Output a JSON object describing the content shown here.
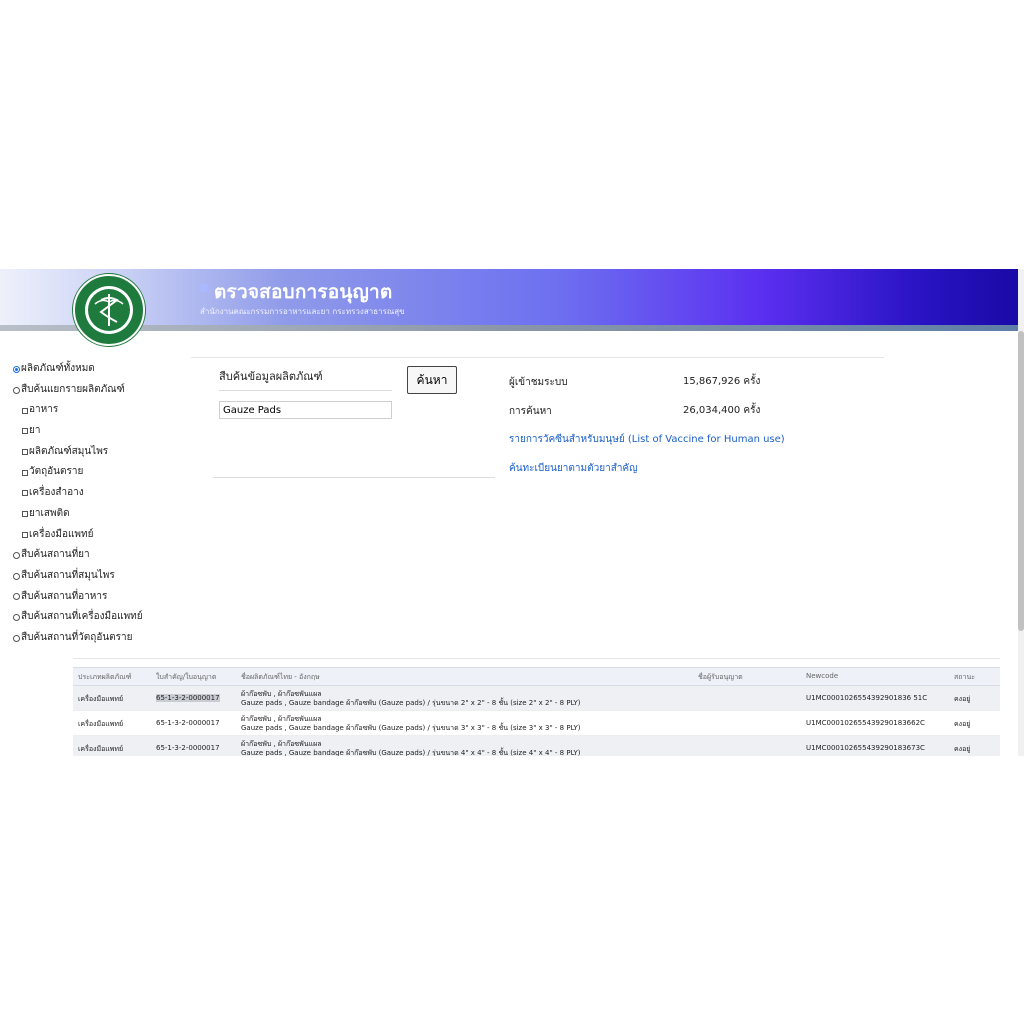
{
  "header": {
    "title": "ตรวจสอบการอนุญาต",
    "subtitle": "สำนักงานคณะกรรมการอาหารและยา กระทรวงสาธารณสุข",
    "logo_text": "กระทรวงสาธารณสุข MINISTRY OF PUBLIC HEALTH"
  },
  "sidebar": {
    "items": [
      {
        "label": "ผลิตภัณฑ์ทั้งหมด",
        "type": "radio",
        "selected": true
      },
      {
        "label": "สืบค้นแยกรายผลิตภัณฑ์",
        "type": "radio",
        "selected": false
      },
      {
        "label": "อาหาร",
        "type": "checkbox"
      },
      {
        "label": "ยา",
        "type": "checkbox"
      },
      {
        "label": "ผลิตภัณฑ์สมุนไพร",
        "type": "checkbox"
      },
      {
        "label": "วัตถุอันตราย",
        "type": "checkbox"
      },
      {
        "label": "เครื่องสำอาง",
        "type": "checkbox"
      },
      {
        "label": "ยาเสพติด",
        "type": "checkbox"
      },
      {
        "label": "เครื่องมือแพทย์",
        "type": "checkbox"
      },
      {
        "label": "สืบค้นสถานที่ยา",
        "type": "radio",
        "selected": false
      },
      {
        "label": "สืบค้นสถานที่สมุนไพร",
        "type": "radio",
        "selected": false
      },
      {
        "label": "สืบค้นสถานที่อาหาร",
        "type": "radio",
        "selected": false
      },
      {
        "label": "สืบค้นสถานที่เครื่องมือแพทย์",
        "type": "radio",
        "selected": false
      },
      {
        "label": "สืบค้นสถานที่วัตถุอันตราย",
        "type": "radio",
        "selected": false
      }
    ]
  },
  "search": {
    "label": "สืบค้นข้อมูลผลิตภัณฑ์",
    "value": "Gauze Pads",
    "button_label": "ค้นหา"
  },
  "stats": {
    "visitors_label": "ผู้เข้าชมระบบ",
    "visitors_value": "15,867,926 ครั้ง",
    "searches_label": "การค้นหา",
    "searches_value": "26,034,400 ครั้ง"
  },
  "links": {
    "vaccine": "รายการวัคซีนสำหรับมนุษย์ (List of Vaccine for Human use)",
    "drug_search": "ค้นทะเบียนยาตามตัวยาสำคัญ"
  },
  "table": {
    "headers": [
      "ประเภทผลิตภัณฑ์",
      "ใบสำคัญ/ใบอนุญาต",
      "ชื่อผลิตภัณฑ์ไทย - อังกฤษ",
      "ชื่อผู้รับอนุญาต",
      "Newcode",
      "สถานะ"
    ],
    "rows": [
      {
        "type": "เครื่องมือแพทย์",
        "license": "65-1-3-2-0000017",
        "name_th": "ผ้าก๊อซพับ , ผ้าก๊อซพันแผล",
        "name_en": "Gauze pads , Gauze bandage ผ้าก๊อซพับ (Gauze pads) / รุ่นขนาด 2\" x 2\" - 8 ชั้น (size 2\" x 2\" - 8 PLY)",
        "licensee": "",
        "newcode": "U1MC0001026554392901836 51C",
        "status": "คงอยู่"
      },
      {
        "type": "เครื่องมือแพทย์",
        "license": "65-1-3-2-0000017",
        "name_th": "ผ้าก๊อซพับ , ผ้าก๊อซพันแผล",
        "name_en": "Gauze pads , Gauze bandage ผ้าก๊อซพับ (Gauze pads) / รุ่นขนาด 3\" x 3\" - 8 ชั้น (size 3\" x 3\" - 8 PLY)",
        "licensee": "",
        "newcode": "U1MC000102655439290183662C",
        "status": "คงอยู่"
      },
      {
        "type": "เครื่องมือแพทย์",
        "license": "65-1-3-2-0000017",
        "name_th": "ผ้าก๊อซพับ , ผ้าก๊อซพันแผล",
        "name_en": "Gauze pads , Gauze bandage ผ้าก๊อซพับ (Gauze pads) / รุ่นขนาด 4\" x 4\" - 8 ชั้น (size 4\" x 4\" - 8 PLY)",
        "licensee": "",
        "newcode": "U1MC000102655439290183673C",
        "status": "คงอยู่"
      }
    ]
  },
  "colors": {
    "banner_start": "#eef1fb",
    "banner_end": "#1a0aa6",
    "link": "#1a5fc8",
    "logo_green": "#1f7a3d"
  }
}
